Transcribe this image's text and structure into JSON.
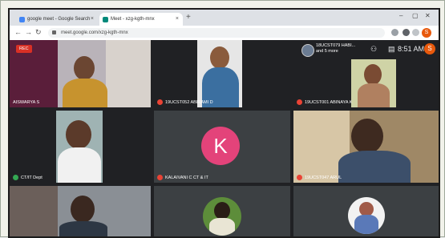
{
  "browser": {
    "tabs": [
      {
        "label": "google meet - Google Search",
        "close": "×"
      },
      {
        "label": "Meet - xzg-kgth-mnx",
        "close": "×"
      }
    ],
    "new_tab": "+",
    "window_controls": {
      "minimize": "–",
      "maximize": "▢",
      "close": "✕"
    },
    "url": "meet.google.com/xzg-kgth-mnx",
    "profile_initial": "S"
  },
  "meet": {
    "recording_badge": "REC",
    "others": {
      "line1": "18UCST079 HABI...",
      "line2": "and 5 more"
    },
    "time": "8:51 AM",
    "self_initial": "S",
    "participants": [
      {
        "name": "AISWARYA S",
        "muted": false
      },
      {
        "name": "19UCST052 ABIRAMI D",
        "muted": true
      },
      {
        "name": "19UCST001 ABINAYA K",
        "muted": true
      },
      {
        "name": "CT/IT Dept",
        "muted": false
      },
      {
        "name": "KALAIVANI C CT & IT",
        "muted": true
      },
      {
        "name": "19UCST047 ARUL",
        "muted": true
      }
    ],
    "tile_initial": "K"
  },
  "colors": {
    "meet_bg": "#202124",
    "rec": "#d93025",
    "muted": "#ea4335",
    "k_avatar": "#e3437a",
    "profile": "#e8590c"
  }
}
